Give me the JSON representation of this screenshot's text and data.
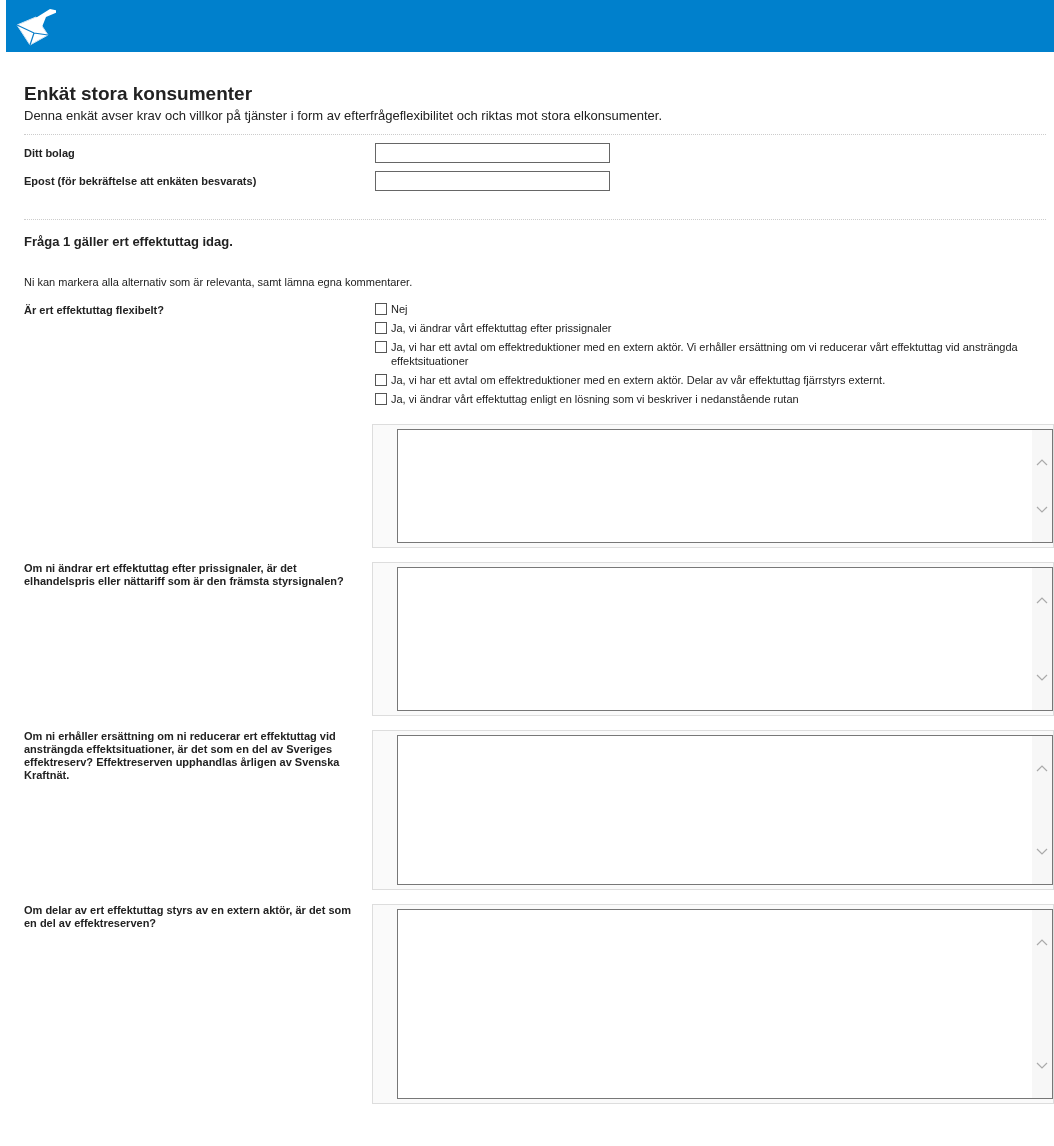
{
  "title": "Enkät stora konsumenter",
  "description": "Denna enkät avser krav och villkor på tjänster i form av efterfrågeflexibilitet och riktas mot stora elkonsumenter.",
  "fields": [
    {
      "label": "Ditt bolag"
    },
    {
      "label": "Epost (för bekräftelse att enkäten besvarats)"
    }
  ],
  "section": {
    "heading": "Fråga 1 gäller ert effektuttag idag.",
    "instruction": "Ni kan markera alla alternativ som är relevanta, samt lämna egna kommentarer."
  },
  "question": {
    "label": "Är ert effektuttag flexibelt?",
    "options": [
      {
        "label": "Nej",
        "checked": false
      },
      {
        "label": "Ja, vi ändrar vårt effektuttag efter prissignaler",
        "checked": false
      },
      {
        "label": "Ja, vi har ett avtal om effektreduktioner med en extern aktör. Vi erhåller ersättning om vi reducerar vårt effektuttag vid ansträngda effektsituationer",
        "checked": false
      },
      {
        "label": "Ja, vi har ett avtal om effektreduktioner med en extern aktör. Delar av vår effektuttag fjärrstyrs externt.",
        "checked": false
      },
      {
        "label": "Ja, vi ändrar vårt effektuttag enligt en lösning som vi beskriver i nedanstående rutan",
        "checked": false
      }
    ],
    "comment_box": true
  },
  "comment_questions": [
    {
      "label": "Om ni ändrar ert effektuttag efter prissignaler, är det elhandelspris eller nättariff som är den främsta styrsignalen?"
    },
    {
      "label": "Om ni erhåller ersättning om ni reducerar ert effektuttag vid ansträngda effektsituationer, är det som en del av Sveriges effektreserv? Effektreserven upphandlas årligen av Svenska Kraftnät."
    },
    {
      "label": "Om delar av ert effektuttag styrs av en extern aktör, är det som en del av effektreserven?"
    }
  ]
}
